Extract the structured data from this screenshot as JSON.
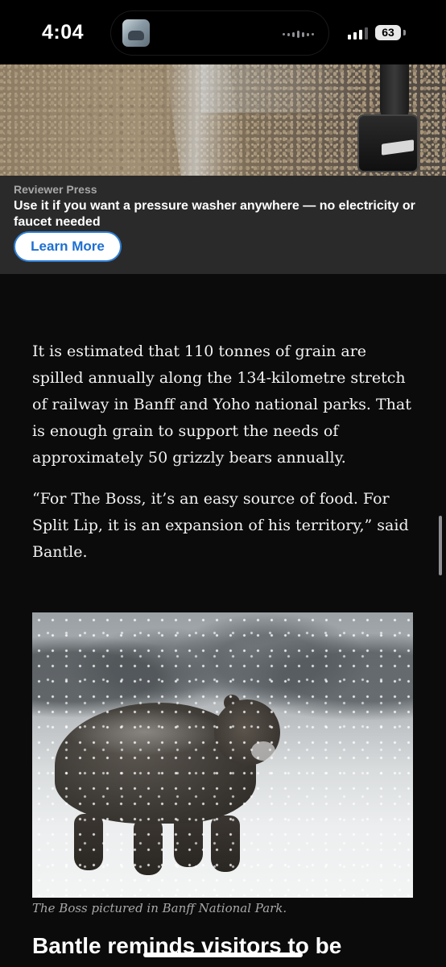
{
  "status_bar": {
    "time": "4:04",
    "battery_level": "63",
    "signal_bars_active": 3
  },
  "ad": {
    "sponsor": "Reviewer Press",
    "headline": "Use it if you want a pressure washer anywhere — no electricity or faucet needed",
    "cta_label": "Learn More",
    "cta_color": "#1d6fd1"
  },
  "article": {
    "paragraphs": [
      "It is estimated that 110 tonnes of grain are spilled annually along the 134-kilometre stretch of railway in Banff and Yoho national parks. That is enough grain to support the needs of approximately 50 grizzly bears annu­ally.",
      "“For The Boss, it’s an easy source of food. For Split Lip, it is an expansion of his territory,” said Bantle."
    ],
    "photo_caption": "The Boss pictured in Banff National Park.",
    "next_heading": "Bantle reminds visitors to be"
  }
}
